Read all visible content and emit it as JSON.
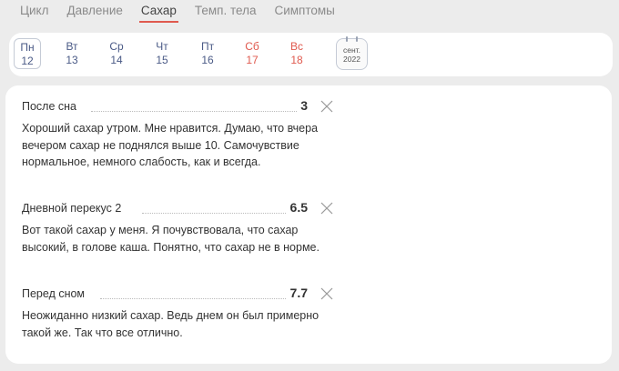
{
  "tabs": [
    {
      "label": "Цикл"
    },
    {
      "label": "Давление"
    },
    {
      "label": "Сахар"
    },
    {
      "label": "Темп. тела"
    },
    {
      "label": "Симптомы"
    }
  ],
  "active_tab": "Сахар",
  "week": [
    {
      "weekday": "Пн",
      "date": "12"
    },
    {
      "weekday": "Вт",
      "date": "13"
    },
    {
      "weekday": "Ср",
      "date": "14"
    },
    {
      "weekday": "Чт",
      "date": "15"
    },
    {
      "weekday": "Пт",
      "date": "16"
    },
    {
      "weekday": "Сб",
      "date": "17"
    },
    {
      "weekday": "Вс",
      "date": "18"
    }
  ],
  "calendar": {
    "month": "сент.",
    "year": "2022"
  },
  "entries": [
    {
      "title": "После сна",
      "value": "3",
      "note": "Хороший сахар утром. Мне нравится. Думаю, что вчера вечером сахар не поднялся выше 10. Самочувствие нормальное, немного слабость, как и всегда."
    },
    {
      "title": "Дневной перекус 2",
      "value": "6.5",
      "note": "Вот такой сахар у меня. Я почувствовала, что сахар высокий, в голове каша. Понятно, что сахар не в норме."
    },
    {
      "title": "Перед сном",
      "value": "7.7",
      "note": "Неожиданно низкий сахар. Ведь днем он был примерно такой же. Так что все отлично."
    }
  ],
  "colors": {
    "accent": "#e05a4f",
    "weekday": "#4a5a86",
    "background": "#ececec"
  }
}
